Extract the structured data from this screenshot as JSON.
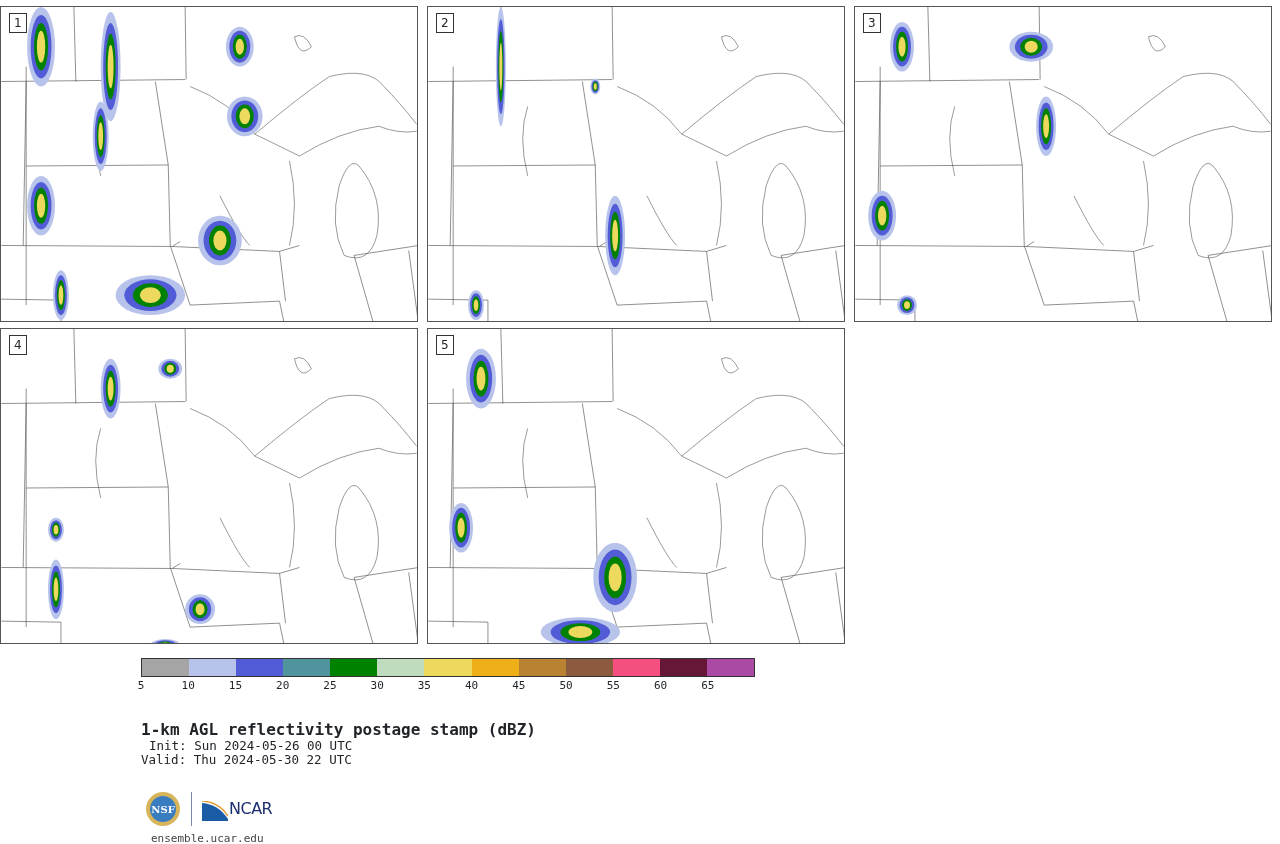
{
  "panels": [
    {
      "label": "1"
    },
    {
      "label": "2"
    },
    {
      "label": "3"
    },
    {
      "label": "4"
    },
    {
      "label": "5"
    }
  ],
  "colorbar": {
    "segments": [
      {
        "color": "#a5a5a5"
      },
      {
        "color": "#b8c3ec"
      },
      {
        "color": "#525cd6"
      },
      {
        "color": "#50959e"
      },
      {
        "color": "#008200"
      },
      {
        "color": "#bfdcbf"
      },
      {
        "color": "#eed95f"
      },
      {
        "color": "#efaf19"
      },
      {
        "color": "#b98232"
      },
      {
        "color": "#8b5a3f"
      },
      {
        "color": "#f44f7e"
      },
      {
        "color": "#661738"
      },
      {
        "color": "#aa4aa4"
      }
    ],
    "tick_labels": [
      "5",
      "10",
      "15",
      "20",
      "25",
      "30",
      "35",
      "40",
      "45",
      "50",
      "55",
      "60",
      "65"
    ]
  },
  "title": "1-km AGL reflectivity postage stamp (dBZ)",
  "init": "Init: Sun 2024-05-26 00 UTC",
  "valid": "Valid: Thu 2024-05-30 22 UTC",
  "logos": {
    "nsf": "NSF",
    "ncar": "NCAR"
  },
  "footer": "ensemble.ucar.edu"
}
